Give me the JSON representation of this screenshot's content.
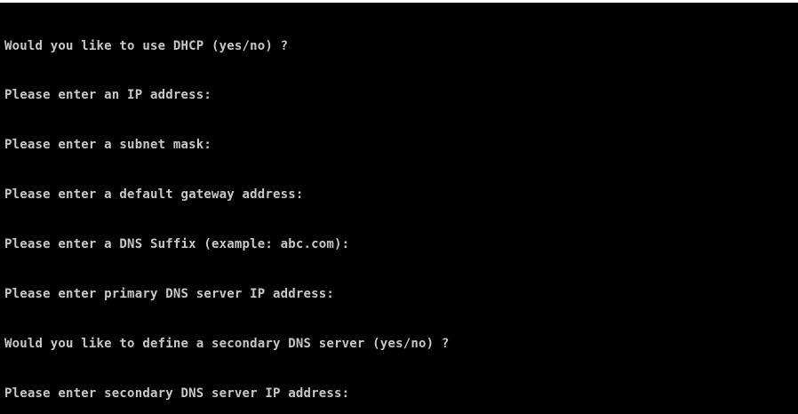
{
  "console": {
    "lines": [
      "Would you like to use DHCP (yes/no) ?",
      "Please enter an IP address:",
      "Please enter a subnet mask:",
      "Please enter a default gateway address:",
      "Please enter a DNS Suffix (example: abc.com):",
      "Please enter primary DNS server IP address:",
      "Would you like to define a secondary DNS server (yes/no) ?",
      "Please enter secondary DNS server IP address:"
    ]
  },
  "colors": {
    "background": "#000000",
    "text": "#c8c8c8"
  }
}
